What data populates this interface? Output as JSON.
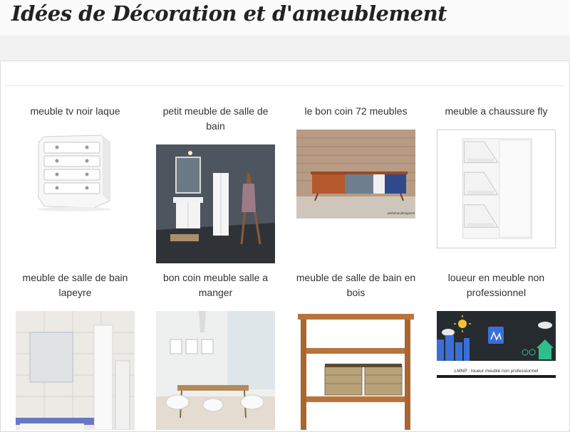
{
  "site": {
    "title": "Idées de Décoration et d'ameublement"
  },
  "gallery": {
    "items": [
      {
        "title": "meuble tv noir laque",
        "image": "white-chest-of-drawers"
      },
      {
        "title": "petit meuble de salle de bain",
        "image": "bathroom-vanity-grey-wall"
      },
      {
        "title": "le bon coin 72 meubles",
        "image": "wood-sideboard-brick-wall",
        "image_caption": "perlumeudesigners"
      },
      {
        "title": "meuble a chaussure fly",
        "image": "white-shoe-cabinet"
      },
      {
        "title": "meuble de salle de bain lapeyre",
        "image": "white-tiled-bathroom"
      },
      {
        "title": "bon coin meuble salle a manger",
        "image": "bright-dining-room"
      },
      {
        "title": "meuble de salle de bain en bois",
        "image": "teak-bathroom-shelf-baskets"
      },
      {
        "title": "loueur en meuble non professionnel",
        "image": "lmnp-illustration",
        "image_caption": "LMNP : loueur meublé non professionnel"
      }
    ]
  }
}
